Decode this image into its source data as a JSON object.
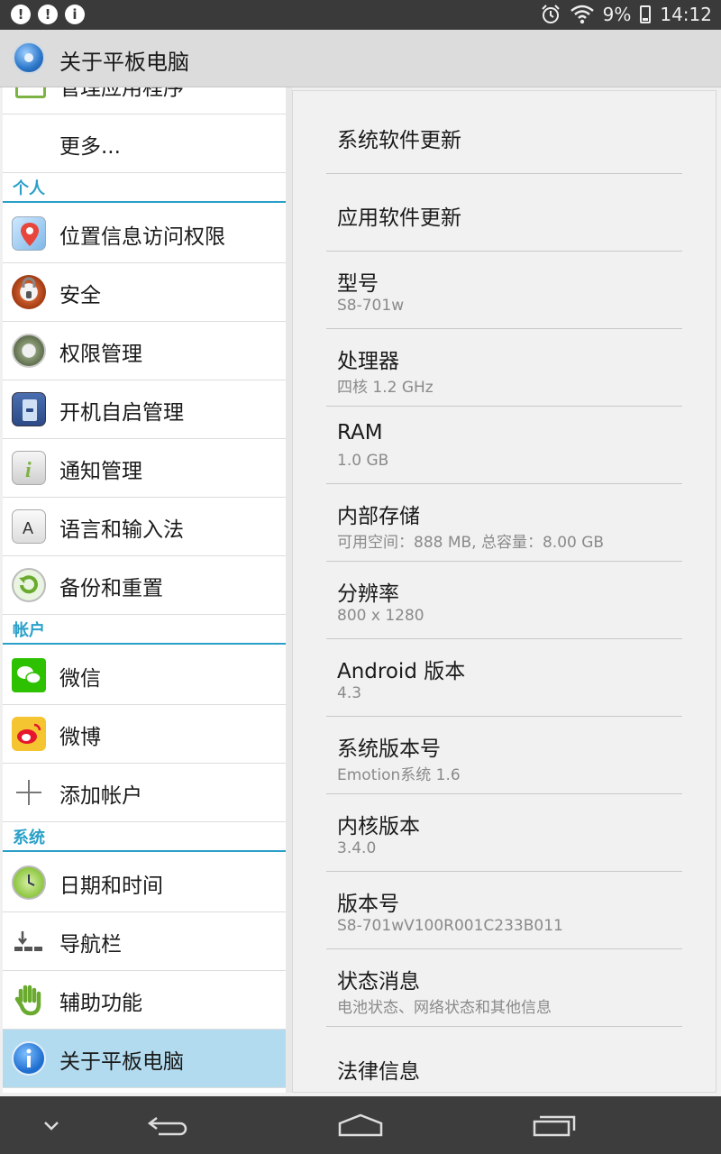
{
  "status_bar": {
    "left_icons": [
      "notification-icon-1",
      "notification-icon-2",
      "info-icon"
    ],
    "battery": "9%",
    "time": "14:12"
  },
  "action_bar": {
    "title": "关于平板电脑",
    "icon": "settings-icon"
  },
  "left_list": {
    "partial_item": "管理应用程序",
    "more": "更多...",
    "sections": {
      "personal": "个人",
      "accounts": "帐户",
      "system": "系统"
    },
    "personal_items": [
      {
        "label": "位置信息访问权限",
        "icon": "location-icon"
      },
      {
        "label": "安全",
        "icon": "lock-icon"
      },
      {
        "label": "权限管理",
        "icon": "permission-icon"
      },
      {
        "label": "开机自启管理",
        "icon": "startup-icon"
      },
      {
        "label": "通知管理",
        "icon": "notification-icon"
      },
      {
        "label": "语言和输入法",
        "icon": "language-icon"
      },
      {
        "label": "备份和重置",
        "icon": "backup-icon"
      }
    ],
    "account_items": [
      {
        "label": "微信",
        "icon": "wechat-icon"
      },
      {
        "label": "微博",
        "icon": "weibo-icon"
      },
      {
        "label": "添加帐户",
        "icon": "plus-icon"
      }
    ],
    "system_items": [
      {
        "label": "日期和时间",
        "icon": "clock-icon"
      },
      {
        "label": "导航栏",
        "icon": "navbar-icon"
      },
      {
        "label": "辅助功能",
        "icon": "hand-icon"
      },
      {
        "label": "关于平板电脑",
        "icon": "info-icon",
        "selected": true
      }
    ]
  },
  "about": {
    "items": [
      {
        "title": "系统软件更新",
        "summary": ""
      },
      {
        "title": "应用软件更新",
        "summary": ""
      },
      {
        "title": "型号",
        "summary": "S8-701w"
      },
      {
        "title": "处理器",
        "summary": "四核 1.2 GHz"
      },
      {
        "title": "RAM",
        "summary": "1.0 GB"
      },
      {
        "title": "内部存储",
        "summary": "可用空间：888  MB, 总容量：8.00  GB"
      },
      {
        "title": "分辨率",
        "summary": "800 x 1280"
      },
      {
        "title": "Android 版本",
        "summary": "4.3"
      },
      {
        "title": "系统版本号",
        "summary": "Emotion系统 1.6"
      },
      {
        "title": "内核版本",
        "summary": "3.4.0"
      },
      {
        "title": "版本号",
        "summary": "S8-701wV100R001C233B011"
      },
      {
        "title": "状态消息",
        "summary": "电池状态、网络状态和其他信息"
      },
      {
        "title": "法律信息",
        "summary": ""
      }
    ]
  },
  "nav_bar": {
    "buttons": [
      "hide-keyboard-icon",
      "back-icon",
      "home-icon",
      "recents-icon"
    ]
  },
  "colors": {
    "accent": "#2aa0c8",
    "selected_bg": "#b3dbef",
    "statusbar_bg": "#3a3a3a",
    "navbar_bg": "#3d3d3d"
  }
}
